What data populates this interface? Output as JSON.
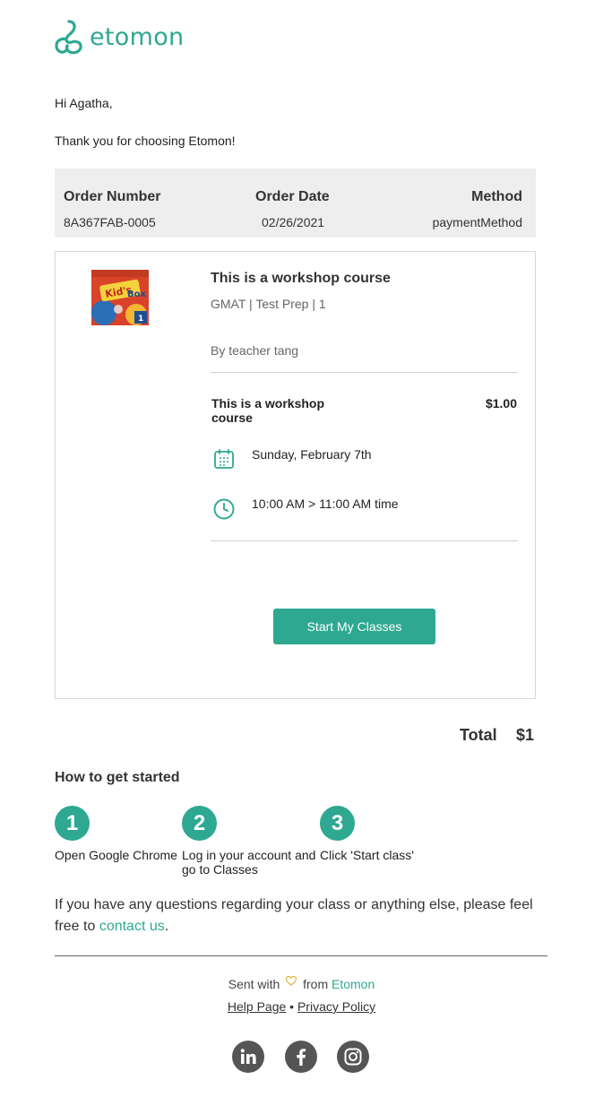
{
  "brand": {
    "name": "etomon",
    "color": "#2ea891"
  },
  "greeting": "Hi Agatha,",
  "thanks": "Thank you for choosing Etomon!",
  "order": {
    "number_label": "Order Number",
    "number_value": "8A367FAB-0005",
    "date_label": "Order Date",
    "date_value": "02/26/2021",
    "method_label": "Method",
    "method_value": "paymentMethod"
  },
  "course": {
    "thumbnail": "kids-box-book-cover",
    "title": "This is a workshop course",
    "meta": "GMAT | Test Prep | 1",
    "teacher": "By teacher tang",
    "line_item_name": "This is a workshop course",
    "line_item_price": "$1.00",
    "date": "Sunday, February 7th",
    "time": "10:00 AM > 11:00 AM time",
    "cta": "Start My Classes"
  },
  "total": {
    "label": "Total",
    "value": "$1"
  },
  "get_started": {
    "title": "How to get started",
    "steps": [
      {
        "num": "1",
        "label": "Open Google Chrome"
      },
      {
        "num": "2",
        "label": "Log in your account and go to Classes"
      },
      {
        "num": "3",
        "label": "Click 'Start class'"
      }
    ]
  },
  "question": {
    "text": "If you have any questions regarding your class or anything else, please feel free to",
    "link": "contact us",
    "end": "."
  },
  "footer": {
    "sent_prefix": "Sent with",
    "sent_from": "from",
    "sent_brand": "Etomon",
    "help": "Help Page",
    "separator": "•",
    "privacy": "Privacy Policy",
    "social": [
      "linkedin-icon",
      "facebook-icon",
      "instagram-icon"
    ]
  }
}
